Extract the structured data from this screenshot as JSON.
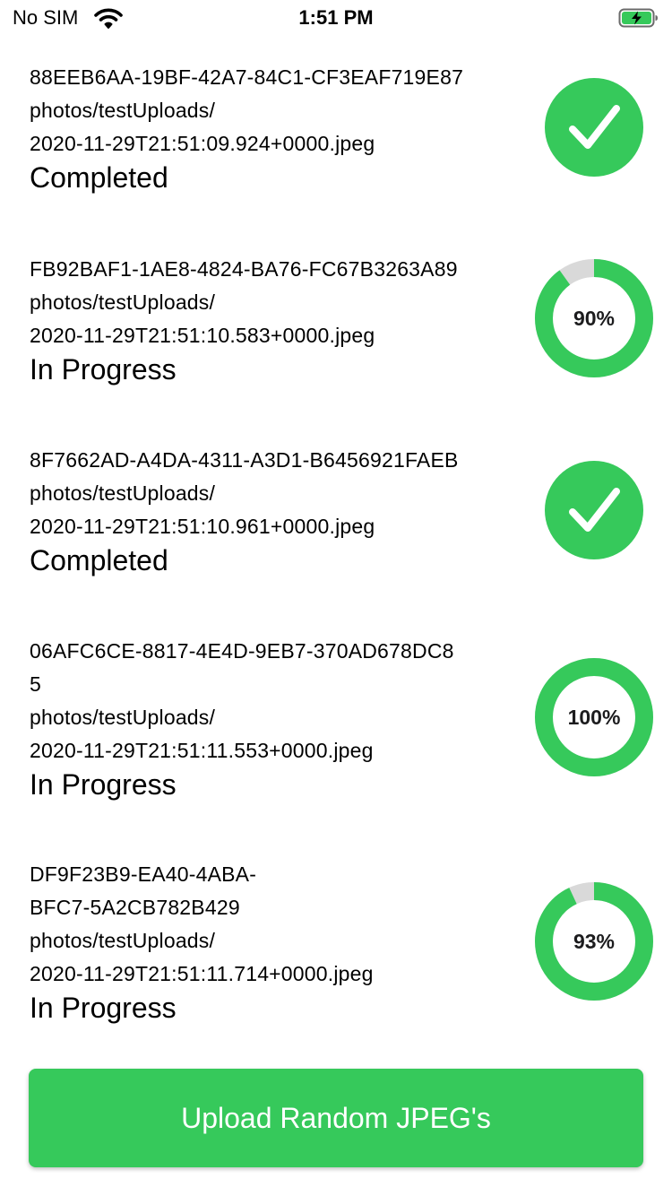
{
  "status_bar": {
    "carrier": "No SIM",
    "time": "1:51 PM"
  },
  "colors": {
    "accent_green": "#36c95b",
    "ring_track": "#d9d9d9"
  },
  "uploads": [
    {
      "id": "88EEB6AA-19BF-42A7-84C1-CF3EAF719E87",
      "folder": "photos/testUploads/",
      "filename": "2020-11-29T21:51:09.924+0000.jpeg",
      "status": "Completed",
      "indicator": "check-icon"
    },
    {
      "id": "FB92BAF1-1AE8-4824-BA76-FC67B3263A89",
      "folder": "photos/testUploads/",
      "filename": "2020-11-29T21:51:10.583+0000.jpeg",
      "status": "In Progress",
      "indicator": "progress-ring",
      "progress_label": "90%",
      "progress": 0.9
    },
    {
      "id": "8F7662AD-A4DA-4311-A3D1-B6456921FAEB",
      "folder": "photos/testUploads/",
      "filename": "2020-11-29T21:51:10.961+0000.jpeg",
      "status": "Completed",
      "indicator": "check-icon"
    },
    {
      "id_line_1": "06AFC6CE-8817-4E4D-9EB7-370AD678DC8",
      "id_line_2": "5",
      "folder": "photos/testUploads/",
      "filename": "2020-11-29T21:51:11.553+0000.jpeg",
      "status": "In Progress",
      "indicator": "progress-ring",
      "progress_label": "100%",
      "progress": 1.0
    },
    {
      "id_line_1": "DF9F23B9-EA40-4ABA-",
      "id_line_2": "BFC7-5A2CB782B429",
      "folder": "photos/testUploads/",
      "filename": "2020-11-29T21:51:11.714+0000.jpeg",
      "status": "In Progress",
      "indicator": "progress-ring",
      "progress_label": "93%",
      "progress": 0.93
    }
  ],
  "upload_button": {
    "label": "Upload Random JPEG's"
  }
}
